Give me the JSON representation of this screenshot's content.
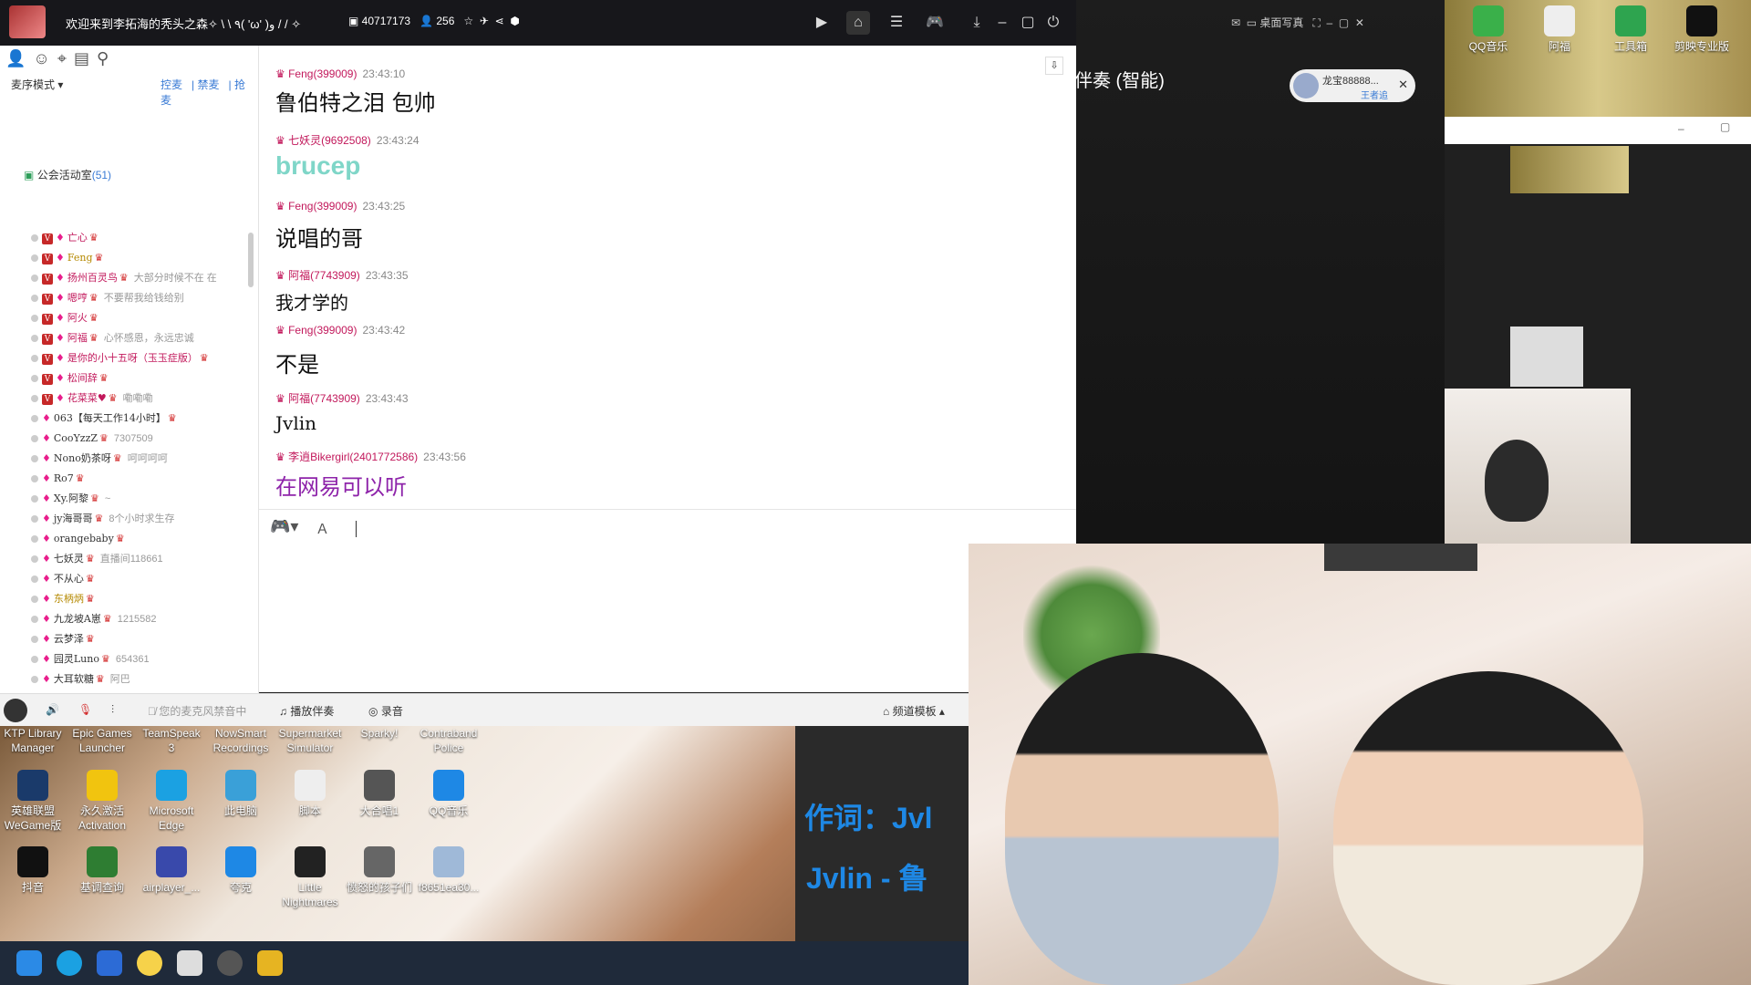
{
  "titlebar": {
    "title": "欢迎来到李拓海的秃头之森✧ \\ \\ ٩( 'ω' )و / / ✧",
    "channel_id": "40717173",
    "online_count": "256"
  },
  "left": {
    "mode": "麦序模式 ▾",
    "link_1": "控麦",
    "link_2": "禁麦",
    "link_3": "抢麦",
    "channel_header": "公会活动室",
    "channel_count": "(51)"
  },
  "members": [
    {
      "nick": "亡心",
      "sig": "",
      "style": "nick"
    },
    {
      "nick": "Feng",
      "sig": "",
      "style": "nick gold"
    },
    {
      "nick": "扬州百灵鸟",
      "sig": "大部分时候不在 在",
      "style": "nick"
    },
    {
      "nick": "嗯哼",
      "sig": "不要帮我给钱给别",
      "style": "nick"
    },
    {
      "nick": "阿火",
      "sig": "",
      "style": "nick"
    },
    {
      "nick": "阿福",
      "sig": "心怀感恩，永远忠诚",
      "style": "nick"
    },
    {
      "nick": "是你的小十五呀（玉玉症版）",
      "sig": "",
      "style": "nick"
    },
    {
      "nick": "松间辞",
      "sig": "",
      "style": "nick"
    },
    {
      "nick": "花菜菜♥",
      "sig": "嘞嘞嘞",
      "style": "nick"
    },
    {
      "nick": "063【每天工作14小时】",
      "sig": "",
      "style": "nick dark"
    },
    {
      "nick": "CooYzzZ",
      "sig": "7307509",
      "style": "nick dark"
    },
    {
      "nick": "Nono奶茶呀",
      "sig": "呵呵呵呵",
      "style": "nick dark"
    },
    {
      "nick": "Ro7",
      "sig": "",
      "style": "nick dark"
    },
    {
      "nick": "Xy.阿黎",
      "sig": "~",
      "style": "nick dark"
    },
    {
      "nick": "jy海哥哥",
      "sig": "8个小时求生存",
      "style": "nick dark"
    },
    {
      "nick": "orangebaby",
      "sig": "",
      "style": "nick dark"
    },
    {
      "nick": "七妖灵",
      "sig": "直播间118661",
      "style": "nick dark"
    },
    {
      "nick": "不从心",
      "sig": "",
      "style": "nick dark"
    },
    {
      "nick": "东柄炳",
      "sig": "",
      "style": "nick gold"
    },
    {
      "nick": "九龙坡A崽",
      "sig": "1215582",
      "style": "nick dark"
    },
    {
      "nick": "云梦泽",
      "sig": "",
      "style": "nick dark"
    },
    {
      "nick": "园灵Luno",
      "sig": "654361",
      "style": "nick dark"
    },
    {
      "nick": "大耳软糖",
      "sig": "阿巴",
      "style": "nick dark"
    }
  ],
  "chat": [
    {
      "user": "Feng(399009)",
      "time": "23:43:10",
      "text": "鲁伯特之泪 包帅",
      "color": "#111"
    },
    {
      "user": "七妖灵(9692508)",
      "time": "23:43:24",
      "text": "brucep",
      "color": "#7fd6c8"
    },
    {
      "user": "Feng(399009)",
      "time": "23:43:25",
      "text": "说唱的哥",
      "color": "#111"
    },
    {
      "user": "阿福(7743909)",
      "time": "23:43:35",
      "text": "我才学的",
      "color": "#111"
    },
    {
      "user": "Feng(399009)",
      "time": "23:43:42",
      "text": "不是",
      "color": "#111"
    },
    {
      "user": "阿福(7743909)",
      "time": "23:43:43",
      "text": "Jvlin",
      "color": "#111"
    },
    {
      "user": "李逍Bikergirl(2401772586)",
      "time": "23:43:56",
      "text": "在网易可以听",
      "color": "#8e24aa"
    }
  ],
  "bottombar": {
    "mic_status": "您的麦克风禁音中",
    "accompany": "播放伴奏",
    "record": "录音",
    "template": "频道模板 ▴"
  },
  "desktop_icons": [
    {
      "label": "KTP Library Manager"
    },
    {
      "label": "Epic Games Launcher"
    },
    {
      "label": "TeamSpeak 3"
    },
    {
      "label": "NowSmart Recordings"
    },
    {
      "label": "Supermarket Simulator"
    },
    {
      "label": "Sparky!"
    },
    {
      "label": "Contraband Police"
    },
    {
      "label": "英雄联盟WeGame版"
    },
    {
      "label": "永久激活 Activation"
    },
    {
      "label": "Microsoft Edge"
    },
    {
      "label": "此电脑"
    },
    {
      "label": "脚本"
    },
    {
      "label": "大合唱1"
    },
    {
      "label": "QQ音乐"
    },
    {
      "label": "抖音"
    },
    {
      "label": "基调查询"
    },
    {
      "label": "airplayer_..."
    },
    {
      "label": "夸克"
    },
    {
      "label": "Little Nightmares"
    },
    {
      "label": "愤怒的孩子们"
    },
    {
      "label": "f8651ea30..."
    }
  ],
  "lyrics": {
    "line1": "作词：Jvl",
    "line2": "Jvlin - 鲁"
  },
  "dark_panel": {
    "accompany_title": "伴奏 (智能)",
    "desktop_record": "桌面写真",
    "popup_name": "龙宝88888...",
    "popup_sub": "王者追"
  },
  "right_top_icons": [
    {
      "label": "QQ音乐"
    },
    {
      "label": "阿福"
    },
    {
      "label": "工具箱"
    },
    {
      "label": "剪映专业版"
    }
  ],
  "colors": {
    "titlebar": "#17171b",
    "link": "#3a7bd5",
    "accent_pink": "#c2185b"
  }
}
